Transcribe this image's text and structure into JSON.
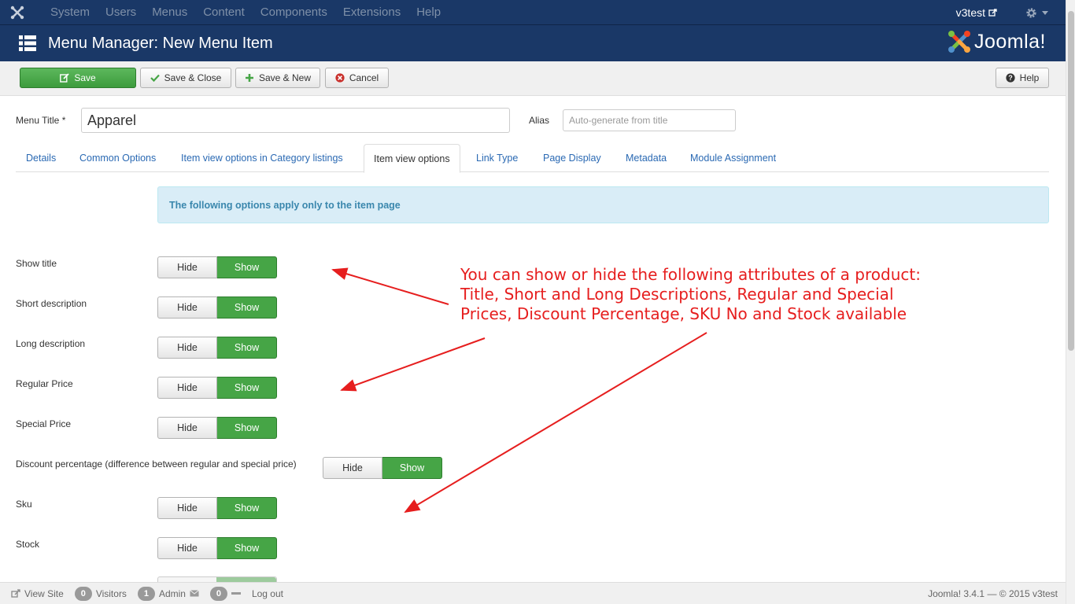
{
  "topnav": {
    "logo_icon": "joomla-icon",
    "menu": [
      "System",
      "Users",
      "Menus",
      "Content",
      "Components",
      "Extensions",
      "Help"
    ],
    "site_name": "v3test",
    "external_icon": "external-link-icon",
    "settings_icon": "gear-icon"
  },
  "header": {
    "title": "Menu Manager: New Menu Item",
    "brand_text": "Joomla!",
    "brand_icon": "joomla-logo"
  },
  "toolbar": {
    "save_label": "Save",
    "save_close_label": "Save & Close",
    "save_new_label": "Save & New",
    "cancel_label": "Cancel",
    "help_label": "Help"
  },
  "form": {
    "menu_title_label": "Menu Title *",
    "menu_title_value": "Apparel",
    "alias_label": "Alias",
    "alias_placeholder": "Auto-generate from title"
  },
  "tabs": [
    {
      "label": "Details",
      "active": false
    },
    {
      "label": "Common Options",
      "active": false
    },
    {
      "label": "Item view options in Category listings",
      "active": false
    },
    {
      "label": "Item view options",
      "active": true
    },
    {
      "label": "Link Type",
      "active": false
    },
    {
      "label": "Page Display",
      "active": false
    },
    {
      "label": "Metadata",
      "active": false
    },
    {
      "label": "Module Assignment",
      "active": false
    }
  ],
  "info_alert": "The following options apply only to the item page",
  "toggle_hide_label": "Hide",
  "toggle_show_label": "Show",
  "options": [
    {
      "label": "Show title",
      "value": "Show"
    },
    {
      "label": "Short description",
      "value": "Show"
    },
    {
      "label": "Long description",
      "value": "Show"
    },
    {
      "label": "Regular Price",
      "value": "Show"
    },
    {
      "label": "Special Price",
      "value": "Show"
    },
    {
      "label": "Discount percentage (difference between regular and special price)",
      "value": "Show"
    },
    {
      "label": "Sku",
      "value": "Show"
    },
    {
      "label": "Stock",
      "value": "Show"
    }
  ],
  "annotation": {
    "line1": "You can show or hide the following attributes of a product:",
    "line2": "Title, Short and Long Descriptions, Regular and Special",
    "line3": "Prices, Discount Percentage, SKU No and Stock available",
    "color": "#e61e1e"
  },
  "statusbar": {
    "view_site": "View Site",
    "visitors_count": "0",
    "visitors_label": "Visitors",
    "admin_count": "1",
    "admin_label": "Admin",
    "messages_count": "0",
    "logout_label": "Log out",
    "copyright": "Joomla! 3.4.1 — © 2015 v3test"
  },
  "colors": {
    "nav_bg": "#1a3867",
    "save_green": "#46a546",
    "link_blue": "#2a69b3",
    "alert_bg": "#d9edf7"
  }
}
